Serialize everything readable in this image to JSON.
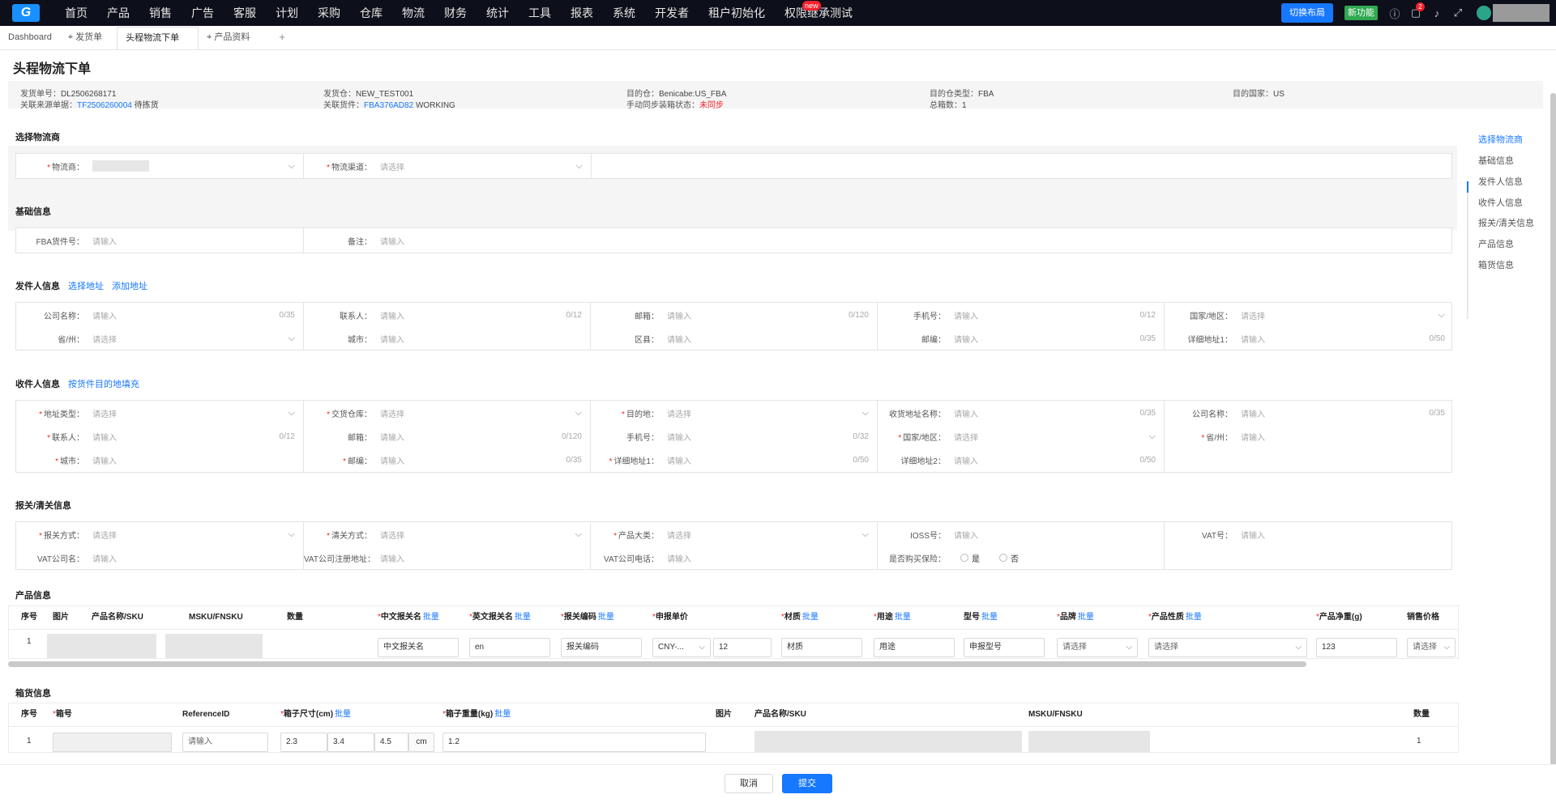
{
  "nav": {
    "logo_text": "G",
    "items": [
      "首页",
      "产品",
      "销售",
      "广告",
      "客服",
      "计划",
      "采购",
      "仓库",
      "物流",
      "财务",
      "统计",
      "工具",
      "报表",
      "系统",
      "开发者",
      "租户初始化",
      "权限继承测试"
    ],
    "badge": "new",
    "layout_button": "切换布局",
    "new_feature": "新功能",
    "bell_badge": "2"
  },
  "tabs": {
    "dashboard": "Dashboard",
    "items": [
      "发货单",
      "头程物流下单",
      "产品资料"
    ],
    "plus": "+"
  },
  "page": {
    "title": "头程物流下单",
    "info": {
      "shipment_no_label": "发货单号：",
      "shipment_no": "DL2506268171",
      "ship_wh_label": "发货仓：",
      "ship_wh": "NEW_TEST001",
      "dest_wh_label": "目的仓：",
      "dest_wh": "Benicabe:US_FBA",
      "dest_type_label": "目的仓类型：",
      "dest_type": "FBA",
      "dest_country_label": "目的国家：",
      "dest_country": "US",
      "source_label": "关联来源单据：",
      "source_no": "TF2506260004",
      "source_status": "待拣货",
      "shipment_link_label": "关联货件：",
      "shipment_link": "FBA376AD82",
      "shipment_link_status": "WORKING",
      "sync_label": "手动同步装箱状态：",
      "sync_status": "未同步",
      "boxes_label": "总箱数：",
      "boxes": "1"
    }
  },
  "common": {
    "input_ph": "请输入",
    "select_ph": "请选择"
  },
  "carrier": {
    "title": "选择物流商",
    "carrier_label": "物流商：",
    "channel_label": "物流渠道："
  },
  "basic": {
    "title": "基础信息",
    "fba_label": "FBA货件号：",
    "remark_label": "备注："
  },
  "sender": {
    "title": "发件人信息",
    "link1": "选择地址",
    "link2": "添加地址",
    "company": "公司名称：",
    "company_cnt": "0/35",
    "contact": "联系人：",
    "contact_cnt": "0/12",
    "email": "邮箱：",
    "email_cnt": "0/120",
    "phone": "手机号：",
    "phone_cnt": "0/12",
    "country": "国家/地区：",
    "province": "省/州：",
    "city": "城市：",
    "district": "区县：",
    "postcode": "邮编：",
    "postcode_cnt": "0/35",
    "address1": "详细地址1：",
    "address1_cnt": "0/50"
  },
  "receiver": {
    "title": "收件人信息",
    "link": "按货件目的地填充",
    "addr_type": "地址类型：",
    "delivery_wh": "交货仓库：",
    "dest": "目的地：",
    "recv_name": "收货地址名称：",
    "recv_name_cnt": "0/35",
    "company": "公司名称：",
    "company_cnt": "0/35",
    "contact": "联系人：",
    "contact_cnt": "0/12",
    "email": "邮箱：",
    "email_cnt": "0/120",
    "phone": "手机号：",
    "phone_cnt": "0/32",
    "country": "国家/地区：",
    "province": "省/州：",
    "city": "城市：",
    "postcode": "邮编：",
    "postcode_cnt": "0/35",
    "address1": "详细地址1：",
    "address1_cnt": "0/50",
    "address2": "详细地址2：",
    "address2_cnt": "0/50"
  },
  "customs": {
    "title": "报关/清关信息",
    "export": "报关方式：",
    "clear": "清关方式：",
    "category": "产品大类：",
    "ioss": "IOSS号：",
    "vat": "VAT号：",
    "vat_company": "VAT公司名：",
    "vat_addr": "VAT公司注册地址：",
    "vat_phone": "VAT公司电话：",
    "insurance": "是否购买保险：",
    "yes": "是",
    "no": "否"
  },
  "products": {
    "title": "产品信息",
    "headers": {
      "seq": "序号",
      "img": "图片",
      "name": "产品名称/SKU",
      "msku": "MSKU/FNSKU",
      "qty": "数量",
      "cn_name": "中文报关名",
      "en_name": "英文报关名",
      "hs": "报关编码",
      "price": "申报单价",
      "material": "材质",
      "usage": "用途",
      "model": "型号",
      "brand": "品牌",
      "nature": "产品性质",
      "weight": "产品净重(g)",
      "sale_price": "销售价格"
    },
    "batch": "批量",
    "row": {
      "seq": "1",
      "cn_name": "中文报关名",
      "en_name": "en",
      "hs": "报关编码",
      "currency": "CNY-...",
      "price": "12",
      "material": "材质",
      "usage": "用途",
      "model": "申报型号",
      "brand_ph": "请选择",
      "nature_ph": "请选择",
      "weight": "123",
      "sale_ph": "请选择"
    }
  },
  "boxes": {
    "title": "箱货信息",
    "headers": {
      "seq": "序号",
      "box_no": "箱号",
      "ref": "ReferenceID",
      "size": "箱子尺寸(cm)",
      "weight": "箱子重量(kg)",
      "img": "图片",
      "name": "产品名称/SKU",
      "msku": "MSKU/FNSKU",
      "qty": "数量"
    },
    "batch": "批量",
    "row": {
      "seq": "1",
      "ref_ph": "请输入",
      "l": "2.3",
      "w": "3.4",
      "h": "4.5",
      "unit": "cm",
      "weight": "1.2",
      "qty": "1"
    }
  },
  "anchor": [
    "选择物流商",
    "基础信息",
    "发件人信息",
    "收件人信息",
    "报关/清关信息",
    "产品信息",
    "箱货信息"
  ],
  "footer": {
    "cancel": "取消",
    "submit": "提交"
  },
  "colors": {
    "primary": "#1677ff",
    "required": "#f5222d",
    "topbar": "#0d0f1a"
  }
}
